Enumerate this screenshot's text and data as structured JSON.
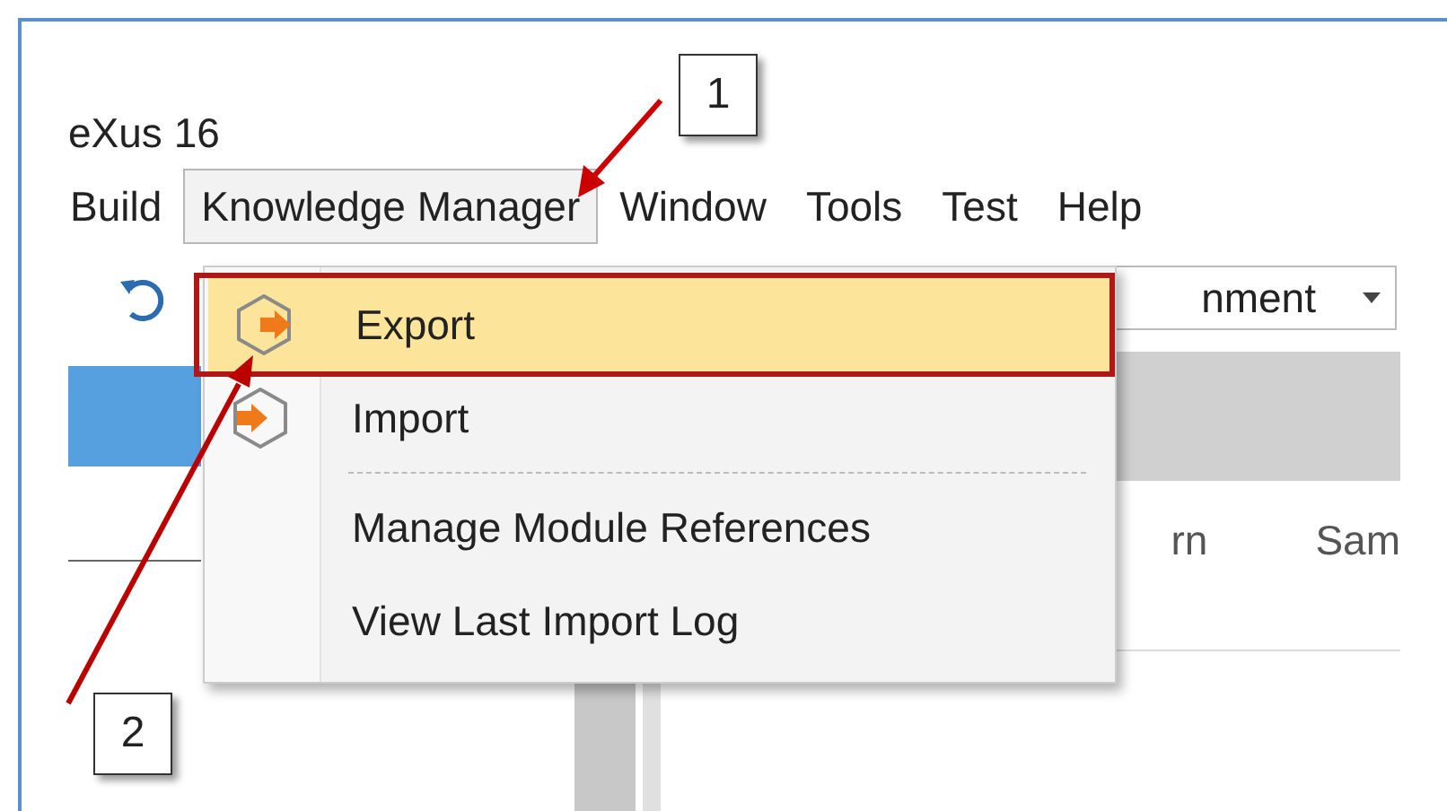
{
  "window": {
    "title": "eXus 16"
  },
  "menu_bar": [
    {
      "label": "Build",
      "selected": false
    },
    {
      "label": "Knowledge Manager",
      "selected": true
    },
    {
      "label": "Window",
      "selected": false
    },
    {
      "label": "Tools",
      "selected": false
    },
    {
      "label": "Test",
      "selected": false
    },
    {
      "label": "Help",
      "selected": false
    }
  ],
  "toolbar": {
    "combo_value": "nment"
  },
  "columns": [
    "rn",
    "Sam"
  ],
  "dropdown_menu": [
    {
      "kind": "export",
      "label": "Export",
      "selected": true
    },
    {
      "kind": "import",
      "label": "Import",
      "selected": false
    },
    {
      "kind": "separator"
    },
    {
      "kind": "plain",
      "label": "Manage Module References",
      "selected": false
    },
    {
      "kind": "plain",
      "label": "View Last Import Log",
      "selected": false
    }
  ],
  "callouts": [
    {
      "number": "1"
    },
    {
      "number": "2"
    }
  ]
}
